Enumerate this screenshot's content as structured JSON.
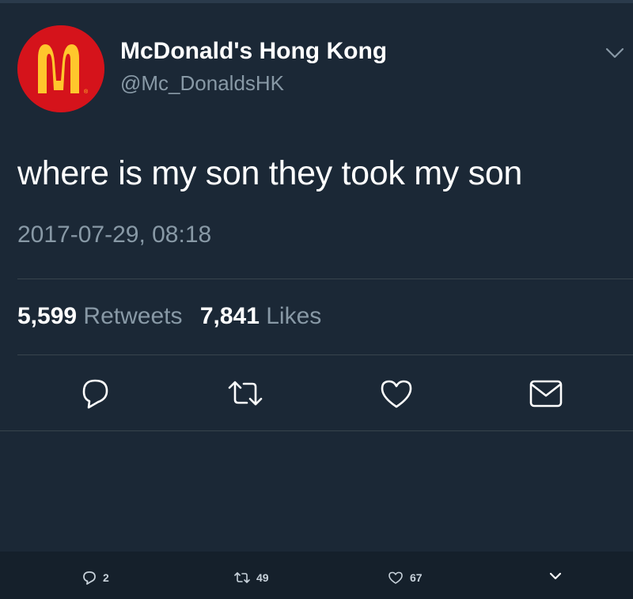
{
  "tweet": {
    "display_name": "McDonald's Hong Kong",
    "handle": "@Mc_DonaldsHK",
    "text": "where is my son they took my son",
    "timestamp": "2017-07-29, 08:18",
    "retweets_count": "5,599",
    "retweets_label": "Retweets",
    "likes_count": "7,841",
    "likes_label": "Likes"
  },
  "actions": [
    {
      "name": "reply",
      "icon": "reply-icon"
    },
    {
      "name": "retweet",
      "icon": "retweet-icon"
    },
    {
      "name": "like",
      "icon": "heart-icon"
    },
    {
      "name": "message",
      "icon": "envelope-icon"
    }
  ],
  "bottom_bar": {
    "reply_count": "2",
    "retweet_count": "49",
    "like_count": "67"
  },
  "colors": {
    "background": "#1b2836",
    "bottom_bar": "#15202b",
    "secondary_text": "#8899a6",
    "divider": "#38444d",
    "avatar_red": "#d5131b",
    "arches_yellow": "#ffc72c"
  }
}
